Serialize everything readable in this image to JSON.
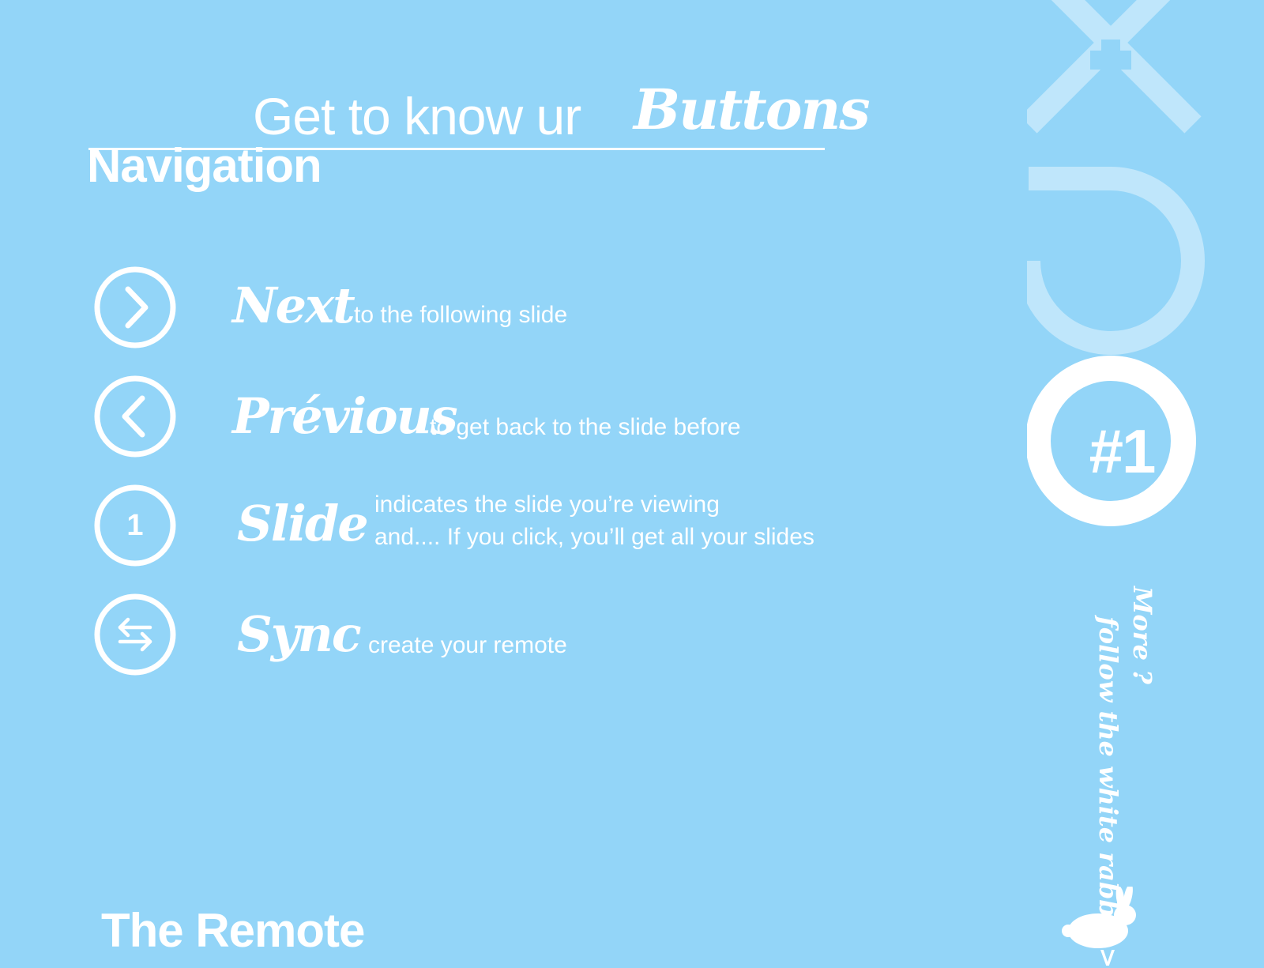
{
  "header": {
    "title_prefix": "Get to know ur",
    "title_emphasis": "Buttons"
  },
  "navigation": {
    "heading": "Navigation",
    "items": [
      {
        "icon": "chevron-right-icon",
        "name": "Next",
        "description": [
          "to the following slide"
        ]
      },
      {
        "icon": "chevron-left-icon",
        "name": "Prévious",
        "description": [
          "to get back to the slide before"
        ]
      },
      {
        "icon": "slide-number-icon",
        "icon_label": "1",
        "name": "Slide",
        "description": [
          "indicates the slide you’re viewing",
          "and.... If you click, you’ll get all your slides"
        ]
      },
      {
        "icon": "sync-arrows-icon",
        "name": "Sync",
        "description": [
          "create your remote"
        ]
      }
    ]
  },
  "remote": {
    "heading": "The Remote"
  },
  "sidebar": {
    "logo": "oxo-logo-icon",
    "badge": "#1",
    "more_label": "More ?",
    "follow_label": "follow the white rabbit >",
    "rabbit_icon": "rabbit-icon"
  },
  "colors": {
    "background": "#93d5f8",
    "foreground": "#ffffff",
    "logo_faded": "#bfe6fb"
  }
}
